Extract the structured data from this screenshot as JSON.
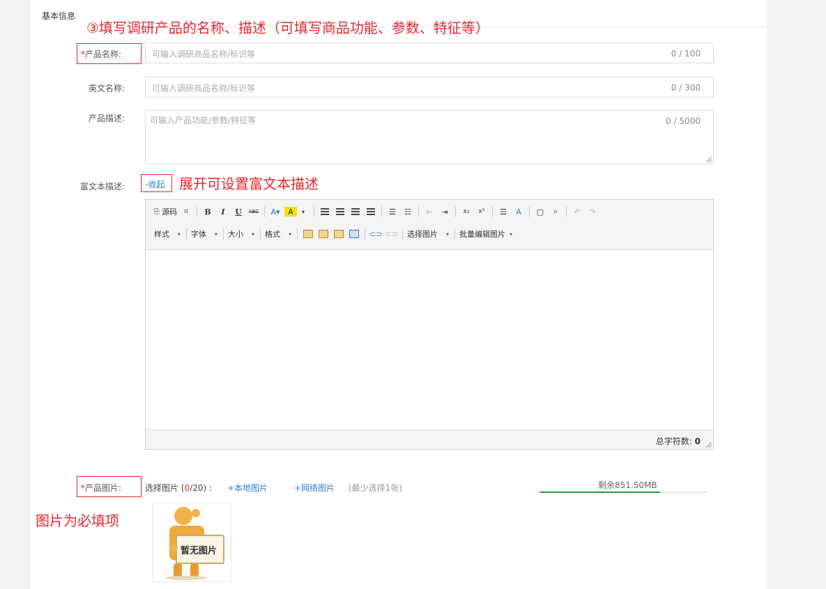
{
  "section": {
    "title": "基本信息"
  },
  "annotations": {
    "step3": "③填写调研产品的名称、描述（可填写商品功能、参数、特征等）",
    "rich_text_hint": "展开可设置富文本描述",
    "image_required": "图片为必填项"
  },
  "product_name": {
    "required_mark": "*",
    "label": "产品名称:",
    "placeholder": "可输入调研商品名称/标识等",
    "count": "0 / 100"
  },
  "english_name": {
    "label": "英文名称:",
    "placeholder": "可输入调研商品名称/标识等",
    "count": "0 / 300"
  },
  "product_desc": {
    "label": "产品描述:",
    "placeholder": "可输入产品功能/参数/特征等",
    "count": "0 / 5000"
  },
  "rich_text": {
    "label": "富文本描述:",
    "toggle": "-收起"
  },
  "editor": {
    "row1": {
      "source": "源码"
    },
    "row2": {
      "style": "样式",
      "font": "字体",
      "size": "大小",
      "format": "格式",
      "choose_image": "选择图片",
      "batch_edit": "批量编辑图片"
    },
    "status_label": "总字符数:",
    "status_count": "0"
  },
  "product_image": {
    "required_mark": "*",
    "label": "产品图片:",
    "select_prefix": "选择图片",
    "paren_open": "(",
    "selected": "0",
    "total": "/20",
    "paren_close": ")",
    "colon": ":",
    "local": "+本地图片",
    "network": "+网络图片",
    "hint": "(最少选择1张)",
    "storage_remaining": "剩余851.50MB",
    "storage_fill_fraction": 0.72,
    "placeholder_text": "暂无图片"
  },
  "colors": {
    "accent": "#e8262f",
    "link": "#2f7bd4",
    "progress": "#1a9f3b"
  }
}
